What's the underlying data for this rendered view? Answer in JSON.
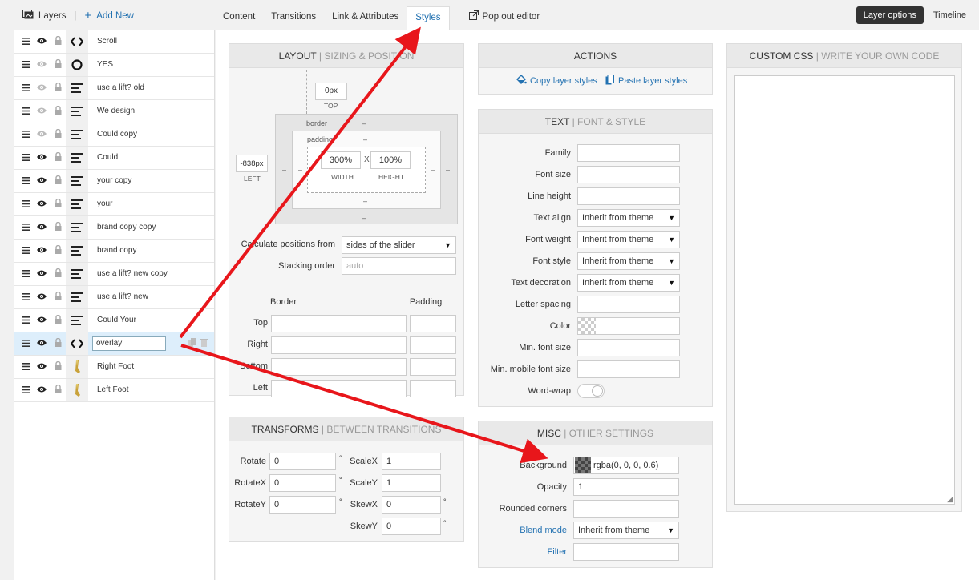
{
  "topbar": {
    "layers_label": "Layers",
    "add_new_label": "Add New",
    "tabs": [
      "Content",
      "Transitions",
      "Link & Attributes",
      "Styles"
    ],
    "popout_label": "Pop out editor",
    "layer_options_label": "Layer options",
    "timeline_label": "Timeline"
  },
  "layers": [
    {
      "name": "Scroll",
      "type_icon": "code-icon",
      "eye_dim": false
    },
    {
      "name": "YES",
      "type_icon": "circle-icon",
      "eye_dim": true
    },
    {
      "name": "use a lift? old",
      "type_icon": "text-icon",
      "eye_dim": true
    },
    {
      "name": "We design",
      "type_icon": "text-icon",
      "eye_dim": true
    },
    {
      "name": "Could copy",
      "type_icon": "text-icon",
      "eye_dim": true
    },
    {
      "name": "Could",
      "type_icon": "text-icon",
      "eye_dim": false
    },
    {
      "name": "your copy",
      "type_icon": "text-icon",
      "eye_dim": false
    },
    {
      "name": "your",
      "type_icon": "text-icon",
      "eye_dim": false
    },
    {
      "name": "brand copy copy",
      "type_icon": "text-icon",
      "eye_dim": false
    },
    {
      "name": "brand copy",
      "type_icon": "text-icon",
      "eye_dim": false
    },
    {
      "name": "use a lift? new copy",
      "type_icon": "text-icon",
      "eye_dim": false
    },
    {
      "name": "use a lift? new",
      "type_icon": "text-icon",
      "eye_dim": false
    },
    {
      "name": "Could Your",
      "type_icon": "text-icon",
      "eye_dim": false
    },
    {
      "name": "overlay",
      "type_icon": "code-icon",
      "eye_dim": false,
      "selected": true
    },
    {
      "name": "Right Foot",
      "type_icon": "image-icon",
      "eye_dim": false
    },
    {
      "name": "Left Foot",
      "type_icon": "image-icon",
      "eye_dim": false
    }
  ],
  "layout": {
    "title": "LAYOUT",
    "subtitle": "SIZING & POSITION",
    "top_value": "0px",
    "top_label": "TOP",
    "left_value": "-838px",
    "left_label": "LEFT",
    "border_label": "border",
    "padding_label": "padding",
    "dash": "–",
    "width_value": "300%",
    "width_label": "WIDTH",
    "times": "X",
    "height_value": "100%",
    "height_label": "HEIGHT",
    "calc_label": "Calculate positions from",
    "calc_value": "sides of the slider",
    "stacking_label": "Stacking order",
    "stacking_placeholder": "auto",
    "border_col": "Border",
    "padding_col": "Padding",
    "sides": [
      "Top",
      "Right",
      "Bottom",
      "Left"
    ]
  },
  "transforms": {
    "title": "TRANSFORMS",
    "subtitle": "BETWEEN TRANSITIONS",
    "left": [
      {
        "label": "Rotate",
        "value": "0"
      },
      {
        "label": "RotateX",
        "value": "0"
      },
      {
        "label": "RotateY",
        "value": "0"
      }
    ],
    "right": [
      {
        "label": "ScaleX",
        "value": "1"
      },
      {
        "label": "ScaleY",
        "value": "1"
      },
      {
        "label": "SkewX",
        "value": "0"
      },
      {
        "label": "SkewY",
        "value": "0"
      }
    ],
    "degree": "°"
  },
  "actions": {
    "title": "ACTIONS",
    "copy_label": "Copy layer styles",
    "paste_label": "Paste layer styles"
  },
  "text": {
    "title": "TEXT",
    "subtitle": "FONT & STYLE",
    "rows": [
      {
        "label": "Family",
        "value": ""
      },
      {
        "label": "Font size",
        "value": ""
      },
      {
        "label": "Line height",
        "value": ""
      },
      {
        "label": "Text align",
        "value": "Inherit from theme",
        "select": true
      },
      {
        "label": "Font weight",
        "value": "Inherit from theme",
        "select": true
      },
      {
        "label": "Font style",
        "value": "Inherit from theme",
        "select": true
      },
      {
        "label": "Text decoration",
        "value": "Inherit from theme",
        "select": true
      },
      {
        "label": "Letter spacing",
        "value": ""
      },
      {
        "label": "Color",
        "value": "",
        "color": true
      },
      {
        "label": "Min. font size",
        "value": ""
      },
      {
        "label": "Min. mobile font size",
        "value": ""
      },
      {
        "label": "Word-wrap",
        "value": "",
        "toggle": true
      }
    ]
  },
  "misc": {
    "title": "MISC",
    "subtitle": "OTHER SETTINGS",
    "background_label": "Background",
    "background_value": "rgba(0, 0, 0, 0.6)",
    "opacity_label": "Opacity",
    "opacity_value": "1",
    "rounded_label": "Rounded corners",
    "blend_label": "Blend mode",
    "blend_value": "Inherit from theme",
    "filter_label": "Filter"
  },
  "css": {
    "title": "CUSTOM CSS",
    "subtitle": "WRITE YOUR OWN CODE"
  },
  "colors": {
    "accent": "#2271b1",
    "arrow": "#e8161b",
    "dark_button": "#333333"
  }
}
